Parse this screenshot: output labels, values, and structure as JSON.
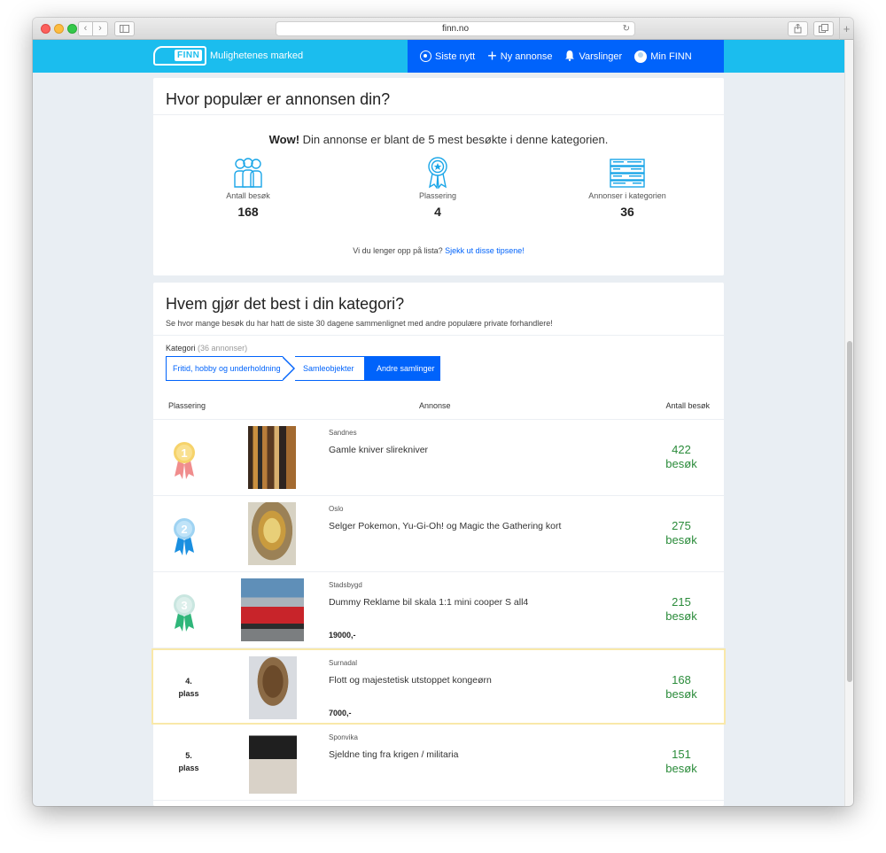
{
  "browser": {
    "url": "finn.no",
    "back": "‹",
    "forward": "›",
    "new_tab": "+"
  },
  "header": {
    "logo_text": "FINN",
    "tagline": "Mulighetenes marked",
    "nav": [
      {
        "label": "Siste nytt",
        "icon": "circle-dot-icon"
      },
      {
        "label": "Ny annonse",
        "icon": "plus-icon"
      },
      {
        "label": "Varslinger",
        "icon": "bell-icon"
      },
      {
        "label": "Min FINN",
        "icon": "avatar-icon"
      }
    ]
  },
  "popularity": {
    "title": "Hvor populær er annonsen din?",
    "wow_bold": "Wow!",
    "wow_text": " Din annonse er blant de 5 mest besøkte i denne kategorien.",
    "stats": [
      {
        "label": "Antall besøk",
        "value": "168",
        "icon": "people-icon"
      },
      {
        "label": "Plassering",
        "value": "4",
        "icon": "ribbon-icon"
      },
      {
        "label": "Annonser i kategorien",
        "value": "36",
        "icon": "list-icon"
      }
    ],
    "tip_text": "Vi du lenger opp på lista? ",
    "tip_link": "Sjekk ut disse tipsene!"
  },
  "ranking": {
    "title": "Hvem gjør det best i din kategori?",
    "subtitle": "Se hvor mange besøk du har hatt de siste 30 dagene sammenlignet med andre populære private forhandlere!",
    "category_label": "Kategori",
    "category_count": "(36 annonser)",
    "breadcrumbs": [
      "Fritid, hobby og underholdning",
      "Samleobjekter",
      "Andre samlinger"
    ],
    "columns": {
      "rank": "Plassering",
      "ad": "Annonse",
      "visits": "Antall besøk"
    },
    "rows": [
      {
        "rank": "1",
        "location": "Sandnes",
        "title": "Gamle kniver slirekniver",
        "price": "",
        "visits": "422",
        "visits_unit": "besøk"
      },
      {
        "rank": "2",
        "location": "Oslo",
        "title": "Selger Pokemon, Yu-Gi-Oh! og Magic the Gathering kort",
        "price": "",
        "visits": "275",
        "visits_unit": "besøk"
      },
      {
        "rank": "3",
        "location": "Stadsbygd",
        "title": "Dummy Reklame bil skala 1:1 mini cooper S all4",
        "price": "19000,-",
        "visits": "215",
        "visits_unit": "besøk"
      },
      {
        "rank": "4.",
        "rank_suffix": "plass",
        "location": "Surnadal",
        "title": "Flott og majestetisk utstoppet kongeørn",
        "price": "7000,-",
        "visits": "168",
        "visits_unit": "besøk"
      },
      {
        "rank": "5.",
        "rank_suffix": "plass",
        "location": "Sponvika",
        "title": "Sjeldne ting fra krigen / militaria",
        "price": "",
        "visits": "151",
        "visits_unit": "besøk"
      }
    ]
  },
  "colors": {
    "finn_blue": "#1bbdee",
    "nav_blue": "#0063fb",
    "visits_green": "#2a8b3a",
    "highlight": "#f9e8a9",
    "gold": "#f6d36b",
    "silver_blue": "#9fd3f2",
    "bronze": "#c9e6e0"
  }
}
